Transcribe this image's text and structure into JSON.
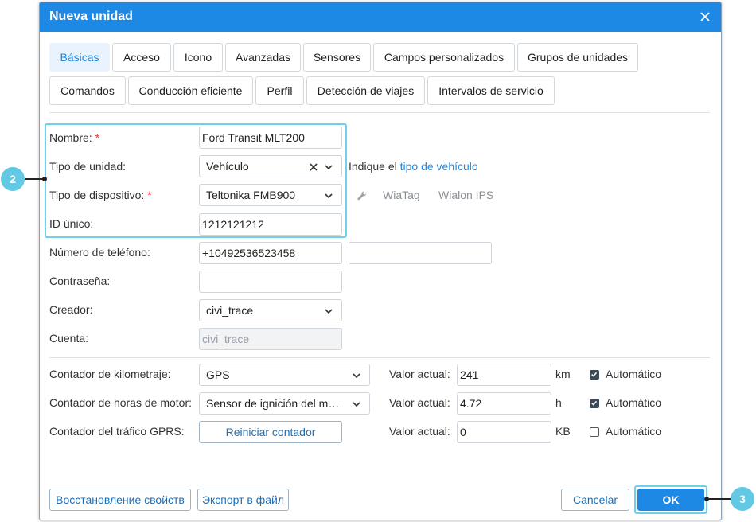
{
  "dialog": {
    "title": "Nueva unidad"
  },
  "tabs": [
    {
      "label": "Básicas"
    },
    {
      "label": "Acceso"
    },
    {
      "label": "Icono"
    },
    {
      "label": "Avanzadas"
    },
    {
      "label": "Sensores"
    },
    {
      "label": "Campos personalizados"
    },
    {
      "label": "Grupos de unidades"
    },
    {
      "label": "Comandos"
    },
    {
      "label": "Conducción eficiente"
    },
    {
      "label": "Perfil"
    },
    {
      "label": "Detección de viajes"
    },
    {
      "label": "Intervalos de servicio"
    }
  ],
  "active_tab": "Básicas",
  "form": {
    "name": {
      "label": "Nombre:",
      "required_mark": "*",
      "value": "Ford Transit MLT200"
    },
    "unit_type": {
      "label": "Tipo de unidad:",
      "value": "Vehículo",
      "hint_prefix": "Indique el",
      "hint_link": "tipo de vehículo"
    },
    "device_type": {
      "label": "Tipo de dispositivo:",
      "required_mark": "*",
      "value": "Teltonika FMB900",
      "option_a": "WiaTag",
      "option_b": "Wialon IPS"
    },
    "unique_id": {
      "label": "ID único:",
      "value": "1212121212"
    },
    "phone": {
      "label": "Número de teléfono:",
      "value": "+10492536523458",
      "second_value": ""
    },
    "password": {
      "label": "Contraseña:",
      "value": ""
    },
    "creator": {
      "label": "Creador:",
      "value": "civi_trace"
    },
    "account": {
      "label": "Cuenta:",
      "value": "civi_trace"
    }
  },
  "counters": {
    "mileage": {
      "label": "Contador de kilometraje:",
      "value": "GPS",
      "current_label": "Valor actual:",
      "current_value": "241",
      "unit": "km",
      "auto_label": "Automático",
      "auto_checked": true
    },
    "engine_hours": {
      "label": "Contador de horas de motor:",
      "value": "Sensor de ignición del motor",
      "current_label": "Valor actual:",
      "current_value": "4.72",
      "unit": "h",
      "auto_label": "Automático",
      "auto_checked": true
    },
    "gprs": {
      "label": "Contador del tráfico GPRS:",
      "button_label": "Reiniciar contador",
      "current_label": "Valor actual:",
      "current_value": "0",
      "unit": "KB",
      "auto_label": "Automático",
      "auto_checked": false
    }
  },
  "footer": {
    "restore_label": "Восстановление свойств",
    "export_label": "Экспорт в файл",
    "cancel_label": "Cancelar",
    "ok_label": "OK"
  },
  "callouts": {
    "fields": "2",
    "ok": "3"
  },
  "colors": {
    "accent": "#1e88e5",
    "highlight": "#6fd0ec",
    "callout": "#63c8e4",
    "required": "#e53935"
  }
}
